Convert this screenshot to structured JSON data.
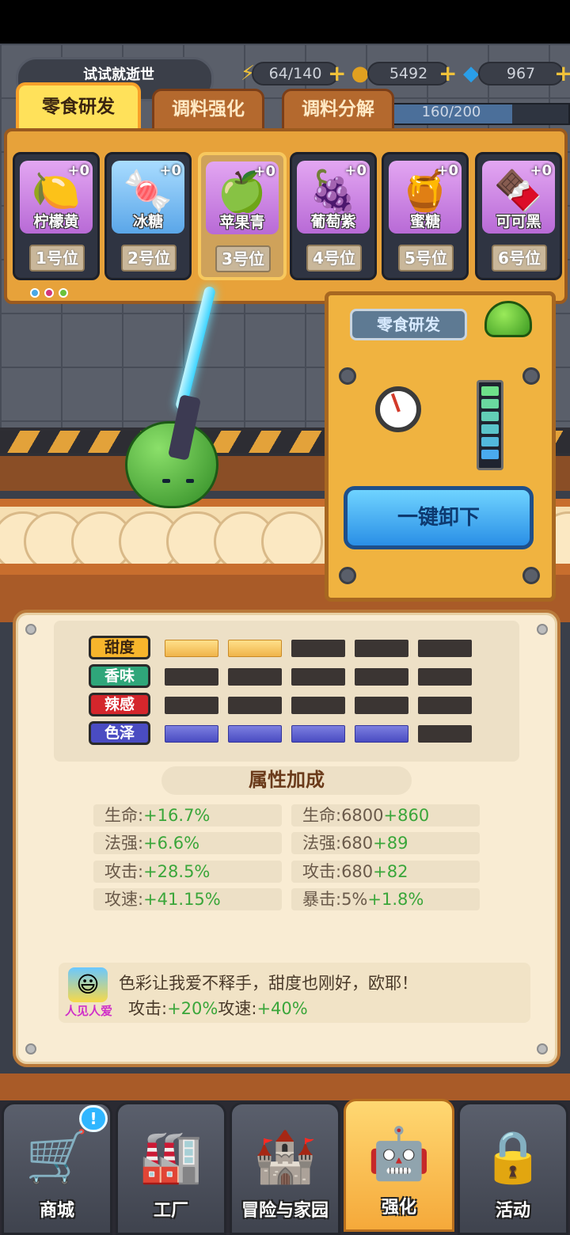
{
  "header": {
    "player_name": "试试就逝世",
    "energy": "64/140",
    "gold": "5492",
    "diamonds": "967",
    "exp": "160/200",
    "exp_fraction": 0.8
  },
  "tabs": [
    {
      "label": "零食研发",
      "active": true
    },
    {
      "label": "调料强化",
      "active": false
    },
    {
      "label": "调料分解",
      "active": false
    }
  ],
  "slots": [
    {
      "name": "柠檬黄",
      "level": "+0",
      "position": "1号位",
      "icon": "lemon-potion-icon",
      "color": "#d28be6"
    },
    {
      "name": "冰糖",
      "level": "+0",
      "position": "2号位",
      "icon": "rock-sugar-candy-icon",
      "color": "#7fc6f5"
    },
    {
      "name": "苹果青",
      "level": "+0",
      "position": "3号位",
      "icon": "apple-potion-icon",
      "color": "#d28be6",
      "selected": true
    },
    {
      "name": "葡萄紫",
      "level": "+0",
      "position": "4号位",
      "icon": "grape-potion-icon",
      "color": "#d28be6"
    },
    {
      "name": "蜜糖",
      "level": "+0",
      "position": "5号位",
      "icon": "honey-candy-icon",
      "color": "#d28be6"
    },
    {
      "name": "可可黑",
      "level": "+0",
      "position": "6号位",
      "icon": "cocoa-potion-icon",
      "color": "#d28be6"
    }
  ],
  "machine": {
    "label": "零食研发",
    "unload_button": "一键卸下"
  },
  "attributes": [
    {
      "label": "甜度",
      "color": "#f7b52c",
      "level": 2,
      "bar": "yellow"
    },
    {
      "label": "香味",
      "color": "#2fa67a",
      "level": 0,
      "bar": "none"
    },
    {
      "label": "辣感",
      "color": "#d4262c",
      "level": 0,
      "bar": "none"
    },
    {
      "label": "色泽",
      "color": "#4a4cc2",
      "level": 4,
      "bar": "blue"
    }
  ],
  "bonus": {
    "title": "属性加成",
    "left": [
      {
        "label": "生命:",
        "value": "+16.7%"
      },
      {
        "label": "法强:",
        "value": "+6.6%"
      },
      {
        "label": "攻击:",
        "value": "+28.5%"
      },
      {
        "label": "攻速:",
        "value": "+41.15%"
      }
    ],
    "right": [
      {
        "label": "生命:6800",
        "value": "+860"
      },
      {
        "label": "法强:680",
        "value": "+89"
      },
      {
        "label": "攻击:680",
        "value": "+82"
      },
      {
        "label": "暴击:5%",
        "value": "+1.8%"
      }
    ]
  },
  "quote": {
    "tag": "人见人爱",
    "text": "色彩让我爱不释手，甜度也刚好，欧耶！",
    "bonus1_label": "攻击:",
    "bonus1_value": "+20%",
    "bonus2_label": "攻速:",
    "bonus2_value": "+40%"
  },
  "nav": [
    {
      "label": "商城",
      "icon": "shopping-cart-icon",
      "active": false
    },
    {
      "label": "工厂",
      "icon": "factory-icon",
      "active": false
    },
    {
      "label": "冒险与家园",
      "icon": "adventure-icon",
      "active": false
    },
    {
      "label": "强化",
      "icon": "robot-upgrade-icon",
      "active": true
    },
    {
      "label": "活动",
      "icon": "lock-icon",
      "active": false
    }
  ],
  "notification_badge": "!"
}
